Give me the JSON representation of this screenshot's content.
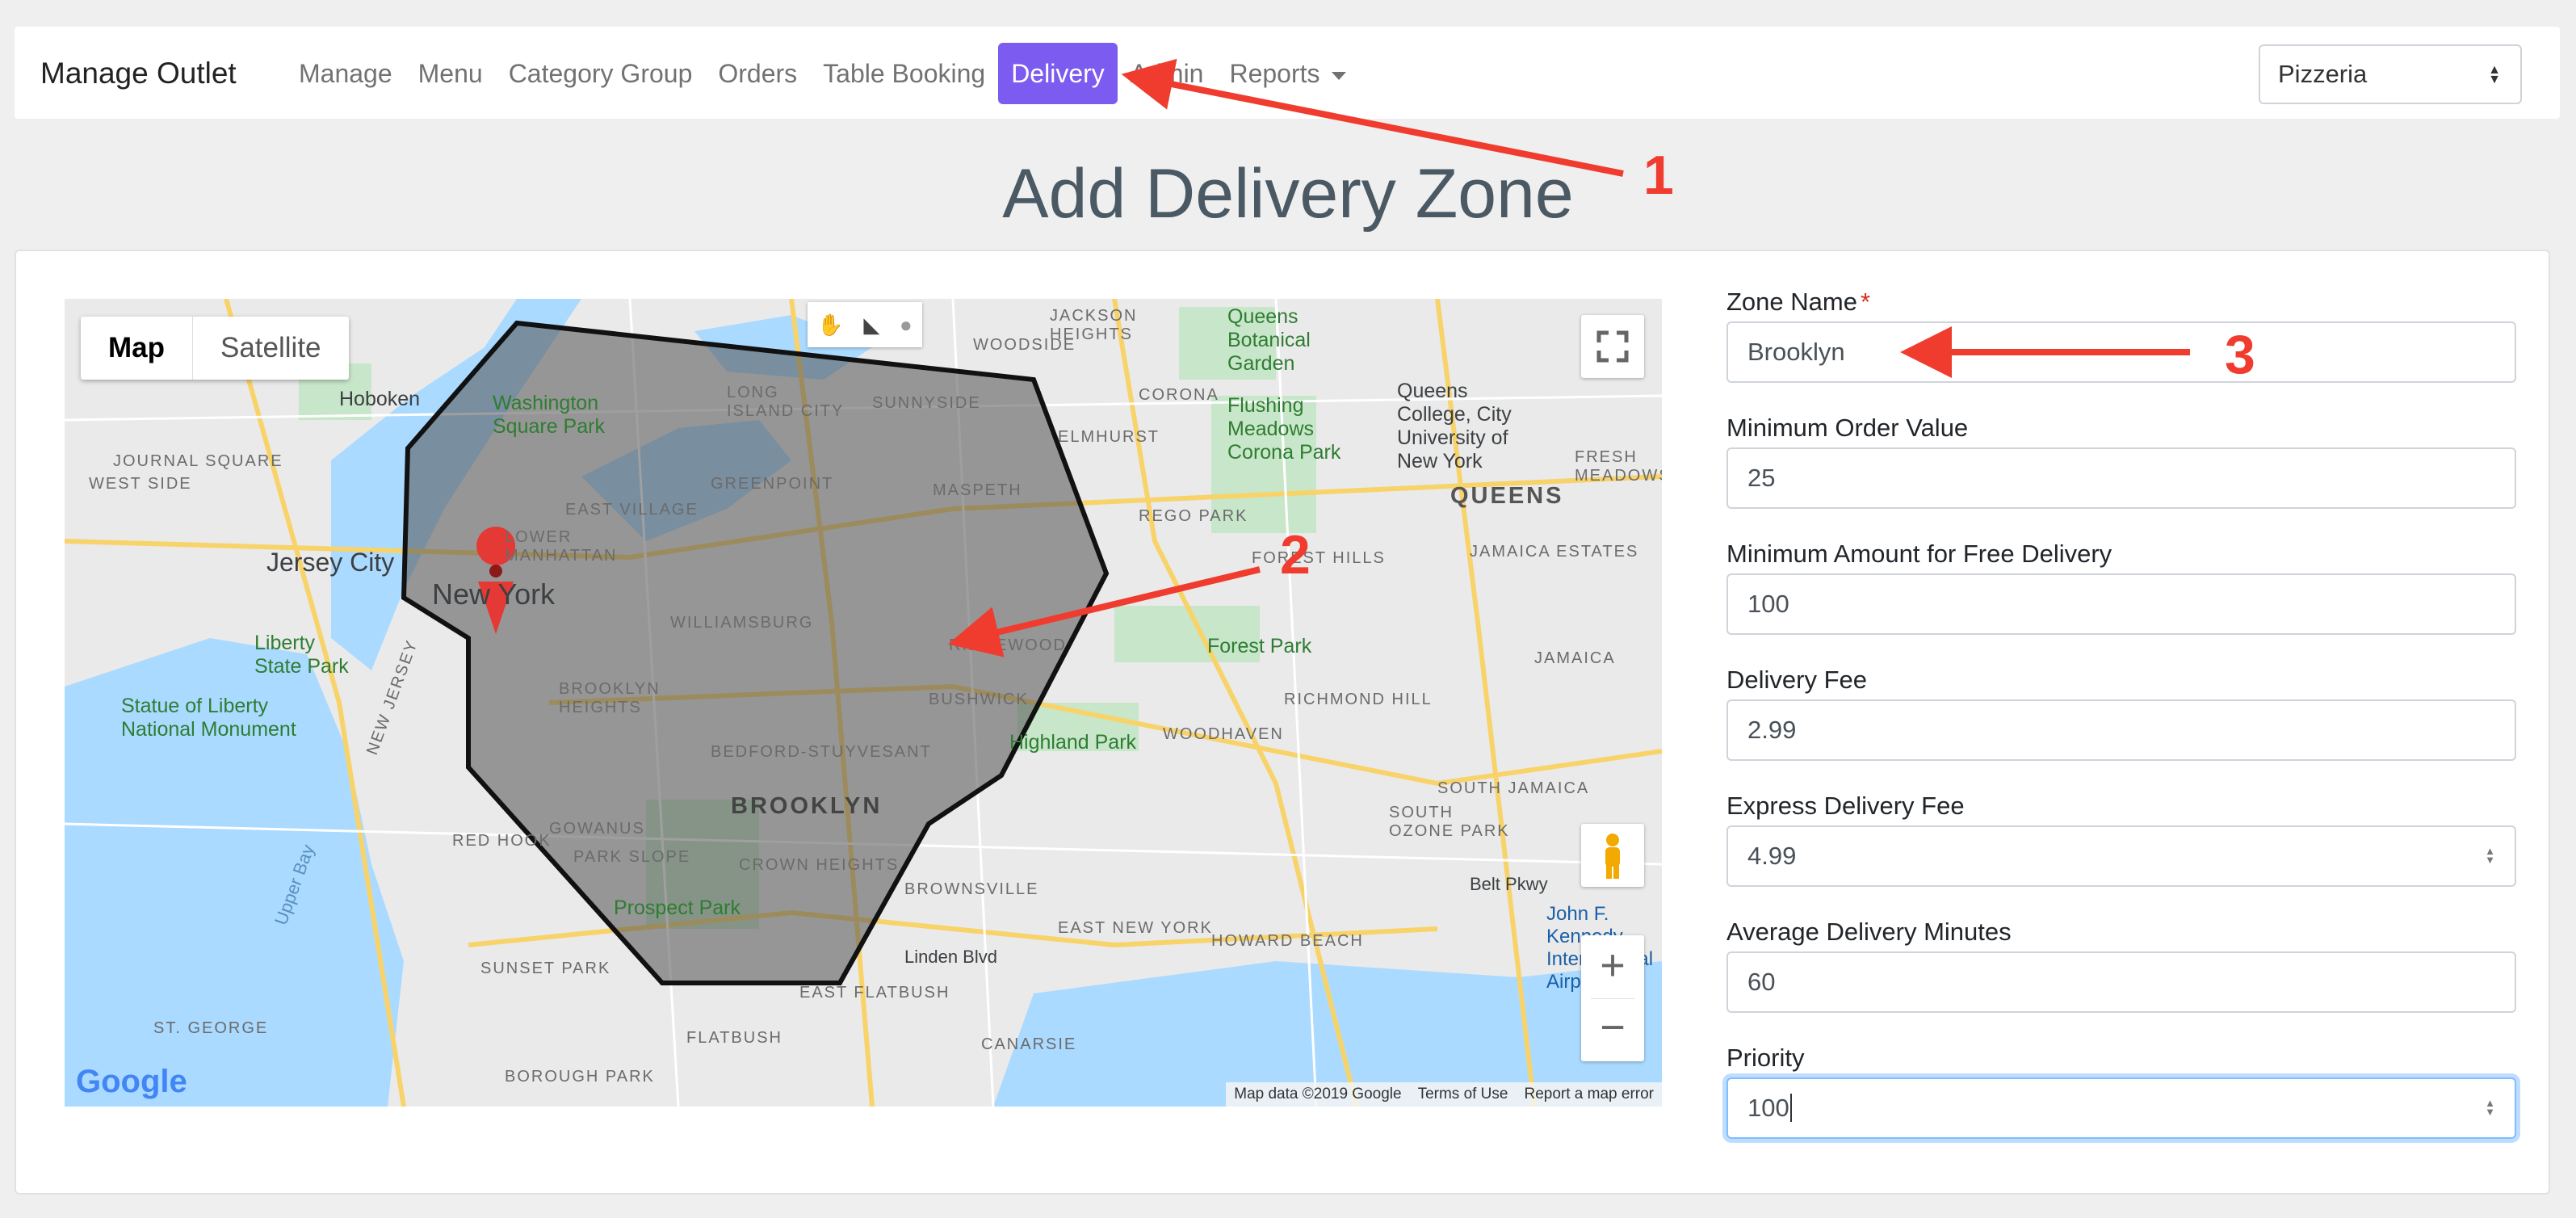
{
  "navbar": {
    "brand": "Manage Outlet",
    "links": [
      "Manage",
      "Menu",
      "Category Group",
      "Orders",
      "Table Booking",
      "Delivery",
      "Admin",
      "Reports"
    ],
    "active": "Delivery",
    "outlet_selected": "Pizzeria"
  },
  "page_title": "Add Delivery Zone",
  "map": {
    "type_buttons": [
      "Map",
      "Satellite"
    ],
    "active_type": "Map",
    "labels": {
      "hoboken": "Hoboken",
      "washington_sq": "Washington\nSquare Park",
      "long_island_city": "LONG\nISLAND CITY",
      "sunnyside": "SUNNYSIDE",
      "woodside": "WOODSIDE",
      "jackson_heights": "JACKSON\nHEIGHTS",
      "queens_garden": "Queens\nBotanical\nGarden",
      "corona": "CORONA",
      "flushing": "Flushing\nMeadows\nCorona Park",
      "queens_college": "Queens\nCollege, City\nUniversity of\nNew York",
      "journal_square": "JOURNAL SQUARE",
      "west_side": "WEST SIDE",
      "greenpoint": "GREENPOINT",
      "maspeth": "MASPETH",
      "elmhurst": "ELMHURST",
      "rego_park": "REGO PARK",
      "queens": "QUEENS",
      "fresh_meadows": "FRESH\nMEADOWS",
      "east_village": "EAST VILLAGE",
      "lower_manhattan": "LOWER\nMANHATTAN",
      "jersey_city": "Jersey City",
      "new_york": "New York",
      "williamsburg": "WILLIAMSBURG",
      "forest_hills": "FOREST HILLS",
      "jamaica_estates": "JAMAICA ESTATES",
      "ridgewood": "RIDGEWOOD",
      "forest_park": "Forest Park",
      "jamaica": "JAMAICA",
      "liberty_park": "Liberty\nState Park",
      "brooklyn_heights": "BROOKLYN\nHEIGHTS",
      "bushwick": "BUSHWICK",
      "richmond_hill": "RICHMOND HILL",
      "statue_of_liberty": "Statue of Liberty\nNational Monument",
      "woodhaven": "WOODHAVEN",
      "bed_stuy": "BEDFORD-STUYVESANT",
      "highland_park": "Highland Park",
      "brooklyn": "BROOKLYN",
      "red_hook": "RED HOOK",
      "gowanus": "GOWANUS",
      "park_slope": "PARK SLOPE",
      "crown_heights": "CROWN HEIGHTS",
      "south_ozone": "SOUTH\nOZONE PARK",
      "south_jamaica": "SOUTH JAMAICA",
      "brownsville": "BROWNSVILLE",
      "prospect_park": "Prospect Park",
      "east_new_york": "EAST NEW YORK",
      "howard_beach": "HOWARD BEACH",
      "sunset_park": "SUNSET PARK",
      "linden_blvd": "Linden Blvd",
      "east_flatbush": "EAST FLATBUSH",
      "jfk": "John F.\nKennedy\nInternational\nAirport",
      "st_george": "ST. GEORGE",
      "flatbush": "FLATBUSH",
      "canarsie": "CANARSIE",
      "borough_park": "BOROUGH PARK",
      "upper_bay": "Upper Bay",
      "new_jersey": "NEW JERSEY",
      "belt_pkwy": "Belt Pkwy"
    },
    "google_logo": "Google",
    "attribution": [
      "Map data ©2019 Google",
      "Terms of Use",
      "Report a map error"
    ]
  },
  "form": {
    "fields": [
      {
        "label": "Zone Name",
        "required": true,
        "value": "Brooklyn"
      },
      {
        "label": "Minimum Order Value",
        "required": false,
        "value": "25"
      },
      {
        "label": "Minimum Amount for Free Delivery",
        "required": false,
        "value": "100"
      },
      {
        "label": "Delivery Fee",
        "required": false,
        "value": "2.99"
      },
      {
        "label": "Express Delivery Fee",
        "required": false,
        "value": "4.99"
      },
      {
        "label": "Average Delivery Minutes",
        "required": false,
        "value": "60"
      },
      {
        "label": "Priority",
        "required": false,
        "value": "100"
      }
    ],
    "required_mark": "*"
  },
  "annotations": [
    "1",
    "2",
    "3"
  ],
  "colors": {
    "active_nav": "#7c5cf0",
    "annotation_red": "#f03c2e",
    "water": "#aadaff",
    "polygon_fill": "#555555"
  }
}
